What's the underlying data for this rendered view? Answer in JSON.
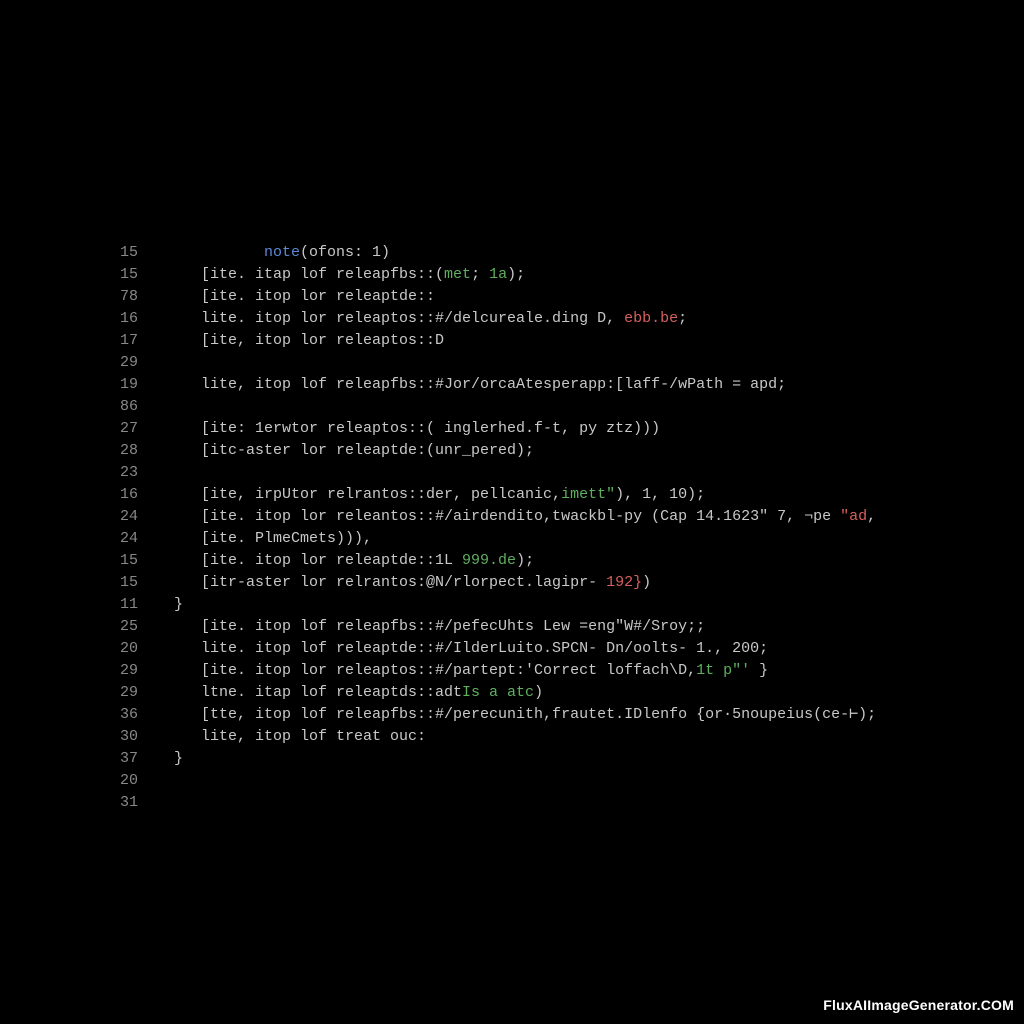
{
  "watermark": "FluxAIImageGenerator.COM",
  "lines": [
    {
      "num": "15",
      "segments": [
        {
          "cls": "k-def",
          "text": "          "
        },
        {
          "cls": "k-blue",
          "text": "note"
        },
        {
          "cls": "k-def",
          "text": "(ofons: 1)"
        }
      ]
    },
    {
      "num": "15",
      "segments": [
        {
          "cls": "k-def",
          "text": "   [ite. itap lof releapfbs::("
        },
        {
          "cls": "k-green",
          "text": "met"
        },
        {
          "cls": "k-def",
          "text": "; "
        },
        {
          "cls": "k-green",
          "text": "1a"
        },
        {
          "cls": "k-def",
          "text": ");"
        }
      ]
    },
    {
      "num": "78",
      "segments": [
        {
          "cls": "k-def",
          "text": "   [ite. itop lor releaptde::"
        }
      ]
    },
    {
      "num": "16",
      "segments": [
        {
          "cls": "k-def",
          "text": "   lite. itop lor releaptos::#/delcureale.ding D, "
        },
        {
          "cls": "k-red",
          "text": "ebb.be"
        },
        {
          "cls": "k-def",
          "text": ";"
        }
      ]
    },
    {
      "num": "17",
      "segments": [
        {
          "cls": "k-def",
          "text": "   [ite, itop lor releaptos::D"
        }
      ]
    },
    {
      "num": "29",
      "segments": [
        {
          "cls": "k-def",
          "text": ""
        }
      ]
    },
    {
      "num": "19",
      "segments": [
        {
          "cls": "k-def",
          "text": "   lite, itop lof releapfbs::#Jor/orcaAtesperapp:[laff-/wPath = apd;"
        }
      ]
    },
    {
      "num": "86",
      "segments": [
        {
          "cls": "k-def",
          "text": ""
        }
      ]
    },
    {
      "num": "27",
      "segments": [
        {
          "cls": "k-def",
          "text": "   [ite: 1erwtor releaptos::( inglerhed.f-t, py ztz)))"
        }
      ]
    },
    {
      "num": "28",
      "segments": [
        {
          "cls": "k-def",
          "text": "   [itc-aster lor releaptde:(unr_pered);"
        }
      ]
    },
    {
      "num": "23",
      "segments": [
        {
          "cls": "k-def",
          "text": ""
        }
      ]
    },
    {
      "num": "16",
      "segments": [
        {
          "cls": "k-def",
          "text": "   [ite, irpUtor relrantos::der, pellcanic,"
        },
        {
          "cls": "k-green",
          "text": "imett\""
        },
        {
          "cls": "k-def",
          "text": "), 1, 10);"
        }
      ]
    },
    {
      "num": "24",
      "segments": [
        {
          "cls": "k-def",
          "text": "   [ite. itop lor releantos::#/airdendito,twackbl-py (Cap 14.1623\" 7, ¬pe "
        },
        {
          "cls": "k-red",
          "text": "\"ad"
        },
        {
          "cls": "k-def",
          "text": ","
        }
      ]
    },
    {
      "num": "24",
      "segments": [
        {
          "cls": "k-def",
          "text": "   [ite. PlmeCmets))),"
        }
      ]
    },
    {
      "num": "15",
      "segments": [
        {
          "cls": "k-def",
          "text": "   [ite. itop lor releaptde::1L "
        },
        {
          "cls": "k-green",
          "text": "999.de"
        },
        {
          "cls": "k-def",
          "text": ");"
        }
      ]
    },
    {
      "num": "15",
      "segments": [
        {
          "cls": "k-def",
          "text": "   [itr-aster lor relrantos:@N/rlorpect.lagipr- "
        },
        {
          "cls": "k-red",
          "text": "192}"
        },
        {
          "cls": "k-def",
          "text": ")"
        }
      ]
    },
    {
      "num": "11",
      "segments": [
        {
          "cls": "k-def",
          "text": "}"
        }
      ]
    },
    {
      "num": "25",
      "segments": [
        {
          "cls": "k-def",
          "text": "   [ite. itop lof releapfbs::#/pefecUhts Lew =eng\"W#/Sroy;;"
        }
      ]
    },
    {
      "num": "20",
      "segments": [
        {
          "cls": "k-def",
          "text": "   lite. itop lof releaptde::#/IlderLuito.SPCN- Dn/oolts- 1., 200;"
        }
      ]
    },
    {
      "num": "29",
      "segments": [
        {
          "cls": "k-def",
          "text": "   [ite. itop lor releaptos::#/partept:'Correct loffach\\D,"
        },
        {
          "cls": "k-green",
          "text": "1t p\"'"
        },
        {
          "cls": "k-def",
          "text": " }"
        }
      ]
    },
    {
      "num": "29",
      "segments": [
        {
          "cls": "k-def",
          "text": "   ltne. itap lof releaptds::adt"
        },
        {
          "cls": "k-green",
          "text": "Is a atc"
        },
        {
          "cls": "k-def",
          "text": ")"
        }
      ]
    },
    {
      "num": "36",
      "segments": [
        {
          "cls": "k-def",
          "text": "   [tte, itop lof releapfbs::#/perecunith,frautet.IDlenfo {or·5noupeius(ce-⊢);"
        }
      ]
    },
    {
      "num": "30",
      "segments": [
        {
          "cls": "k-def",
          "text": "   lite, itop lof treat ouc:"
        }
      ]
    },
    {
      "num": "37",
      "segments": [
        {
          "cls": "k-def",
          "text": "}"
        }
      ]
    },
    {
      "num": "20",
      "segments": [
        {
          "cls": "k-def",
          "text": ""
        }
      ]
    },
    {
      "num": "31",
      "segments": [
        {
          "cls": "k-def",
          "text": ""
        }
      ]
    }
  ]
}
